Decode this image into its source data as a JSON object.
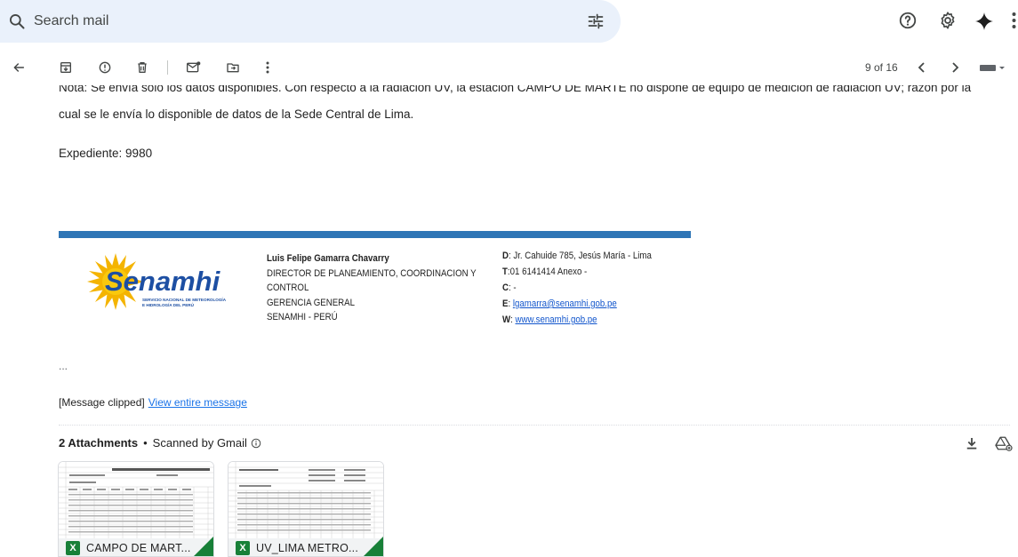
{
  "search": {
    "placeholder": "Search mail"
  },
  "header_icons": [
    "help-icon",
    "gear-icon",
    "gemini-icon",
    "apps-icon"
  ],
  "toolbar": {
    "icons": [
      "back-icon",
      "archive-icon",
      "report-spam-icon",
      "delete-icon",
      "mark-unread-icon",
      "move-to-icon",
      "more-icon"
    ],
    "pager": "9 of 16"
  },
  "message": {
    "line1": "Nota: Se envía solo los datos disponibles. Con respecto a la radiación UV, la estación CAMPO DE MARTE no dispone de equipo de medición de radiación UV; razón por la",
    "line2": "cual se le envía lo disponible de datos de la Sede Central de Lima.",
    "expediente": "Expediente: 9980"
  },
  "signature": {
    "logo_text": "Senamhi",
    "logo_subtitle_1": "SERVICIO NACIONAL DE METEOROLOGÍA",
    "logo_subtitle_2": "E HIDROLOGÍA DEL PERÚ",
    "name": "Luis Felipe Gamarra Chavarry",
    "title_1": "DIRECTOR DE PLANEAMIENTO, COORDINACION Y",
    "title_2": "CONTROL",
    "dept": "GERENCIA GENERAL",
    "org": "SENAMHI - PERÚ",
    "d_label": "D",
    "d_value": ": Jr. Cahuide 785, Jesús María - Lima",
    "t_label": "T",
    "t_value": ":01 6141414 Anexo -",
    "c_label": "C",
    "c_value": ": -",
    "e_label": "E",
    "e_value": "lgamarra@senamhi.gob.pe",
    "w_label": "W",
    "w_value": "www.senamhi.gob.pe"
  },
  "ellipsis": "...",
  "clipped": {
    "text": "[Message clipped]",
    "link": "View entire message"
  },
  "attachments": {
    "count_label": "2 Attachments",
    "separator": "•",
    "scanned": "Scanned by Gmail",
    "items": [
      {
        "name": "CAMPO DE MART...",
        "type": "xlsx",
        "color": "#188038"
      },
      {
        "name": "UV_LIMA METRO...",
        "type": "xlsx",
        "color": "#188038"
      }
    ]
  },
  "colors": {
    "accent_blue": "#2e75b6",
    "link": "#1a73e8",
    "excel_green": "#188038",
    "search_bg": "#eaf1fb"
  }
}
